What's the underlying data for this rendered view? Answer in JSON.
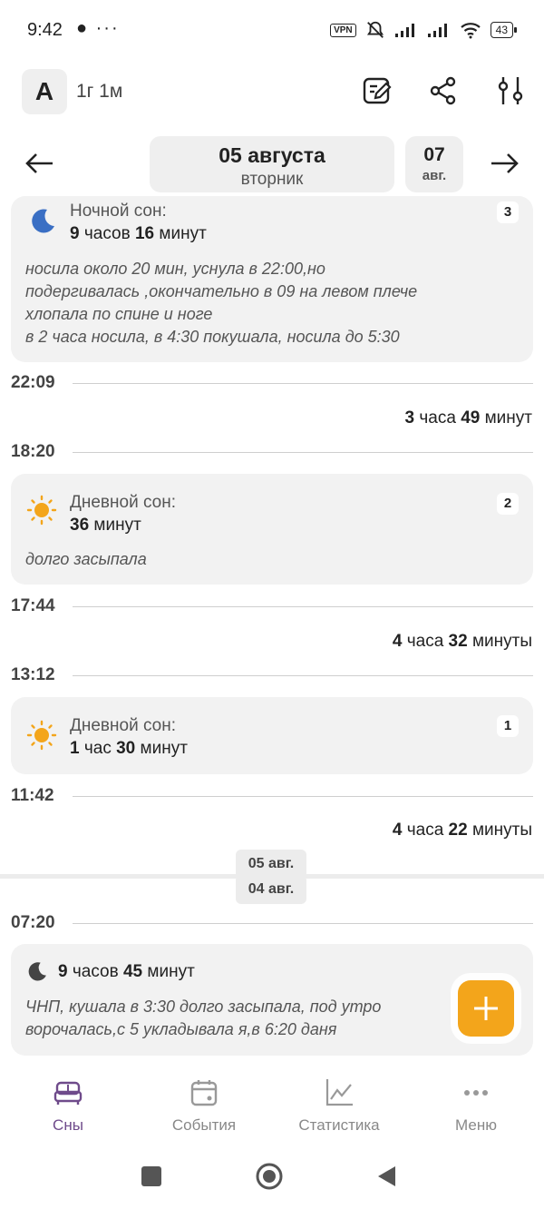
{
  "status": {
    "time": "9:42",
    "left_icons": "● ···",
    "vpn": "VPN",
    "battery": "43"
  },
  "header": {
    "avatar_letter": "A",
    "age": "1г 1м",
    "icons": [
      "edit-note-icon",
      "share-icon",
      "sliders-icon"
    ]
  },
  "date_nav": {
    "date": "05 августа",
    "weekday": "вторник",
    "next_day": "07",
    "next_month": "авг."
  },
  "timeline": {
    "night_card": {
      "label": "Ночной сон:",
      "dur_h": "9",
      "dur_h_unit": " часов ",
      "dur_m": "16",
      "dur_m_unit": " минут",
      "number": "3",
      "note_lines": [
        "носила около 20 мин, уснула в 22:00,но",
        "подергивалась ,окончательно в 09 на левом плече",
        "хлопала по спине и ноге",
        "в 2 часа носила, в 4:30 покушала, носила до 5:30"
      ]
    },
    "t1": "22:09",
    "gap1": {
      "h": "3",
      "h_unit": " часа ",
      "m": "49",
      "m_unit": " минут"
    },
    "t2": "18:20",
    "day_card2": {
      "label": "Дневной сон:",
      "dur_m": "36",
      "dur_m_unit": " минут",
      "number": "2",
      "note": "долго засыпала"
    },
    "t3": "17:44",
    "gap2": {
      "h": "4",
      "h_unit": " часа ",
      "m": "32",
      "m_unit": " минуты"
    },
    "t4": "13:12",
    "day_card1": {
      "label": "Дневной сон:",
      "dur_h": "1",
      "dur_h_unit": " час ",
      "dur_m": "30",
      "dur_m_unit": " минут",
      "number": "1"
    },
    "t5": "11:42",
    "gap3": {
      "h": "4",
      "h_unit": " часа ",
      "m": "22",
      "m_unit": " минуты"
    },
    "chip_top": "05 авг.",
    "chip_bottom": "04 авг.",
    "t6": "07:20",
    "prev_card": {
      "dur_h": "9",
      "dur_h_unit": " часов ",
      "dur_m": "45",
      "dur_m_unit": " минут",
      "note_lines": [
        "ЧНП, кушала в 3:30 долго засыпала, под утро",
        "ворочалась,с 5 укладывала я,в 6:20 даня"
      ]
    }
  },
  "bottom_nav": {
    "items": [
      {
        "label": "Сны",
        "icon": "bed-icon"
      },
      {
        "label": "События",
        "icon": "calendar-icon"
      },
      {
        "label": "Статистика",
        "icon": "chart-icon"
      },
      {
        "label": "Меню",
        "icon": "more-icon"
      }
    ]
  },
  "colors": {
    "accent": "#6f4b8b",
    "fab": "#f3a51b",
    "moon": "#3a6fc4",
    "sun": "#f3a51b"
  }
}
